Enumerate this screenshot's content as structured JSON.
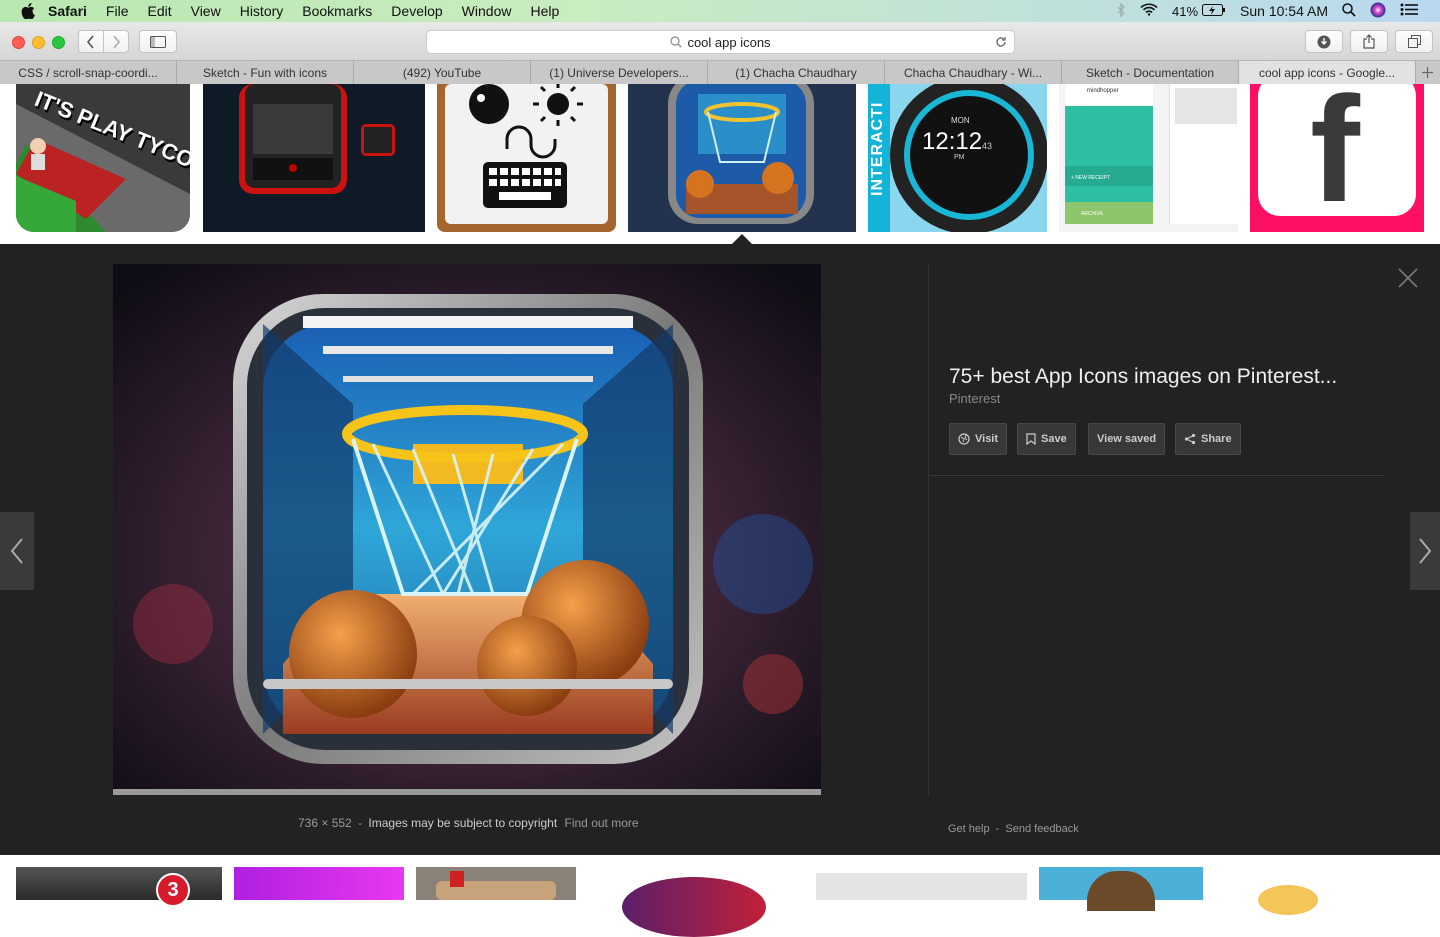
{
  "menubar": {
    "app": "Safari",
    "items": [
      "File",
      "Edit",
      "View",
      "History",
      "Bookmarks",
      "Develop",
      "Window",
      "Help"
    ],
    "battery": "41%",
    "clock": "Sun 10:54 AM"
  },
  "browser": {
    "url": "cool app icons",
    "tabs": [
      {
        "label": "CSS / scroll-snap-coordi..."
      },
      {
        "label": "Sketch - Fun with icons"
      },
      {
        "label": "(492) YouTube"
      },
      {
        "label": "(1) Universe Developers..."
      },
      {
        "label": "(1) Chacha Chaudhary"
      },
      {
        "label": "Chacha Chaudhary - Wi..."
      },
      {
        "label": "Sketch - Documentation"
      },
      {
        "label": "cool app icons - Google..."
      }
    ]
  },
  "thumbnails": {
    "tycoon_text": "IT'S PLAY TYCOON",
    "watch_day": "MON",
    "watch_time": "12:12",
    "watch_sec": "43",
    "watch_pm": "PM",
    "watch_side": "INTERACTI",
    "app_brand": "mindhopper",
    "app_new_receipt": "+ NEW RECEIPT",
    "app_archive": "ARCHIVE",
    "facebook_letter": "f"
  },
  "viewer": {
    "title": "75+ best App Icons images on Pinterest...",
    "source": "Pinterest",
    "buttons": {
      "visit": "Visit",
      "save": "Save",
      "view_saved": "View saved",
      "share": "Share"
    },
    "dimensions": "736 × 552",
    "separator": "-",
    "copyright": "Images may be subject to copyright",
    "find_out_more": "Find out more",
    "get_help": "Get help",
    "send_feedback": "Send feedback",
    "badge_count": "3"
  },
  "colors": {
    "accent_red": "#fd5f57",
    "accent_yellow": "#febc2e",
    "accent_green": "#28c840",
    "viewer_bg": "#222222"
  }
}
